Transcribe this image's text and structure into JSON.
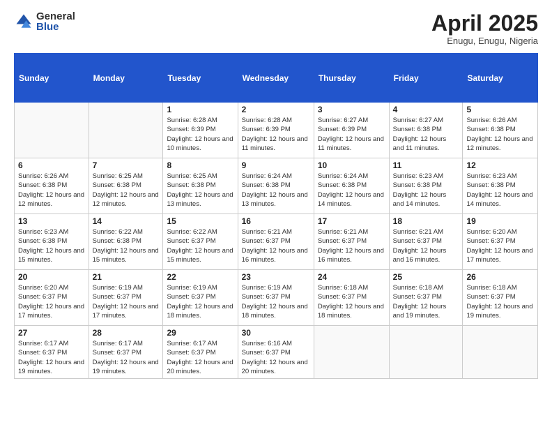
{
  "logo": {
    "general": "General",
    "blue": "Blue"
  },
  "title": {
    "month_year": "April 2025",
    "location": "Enugu, Enugu, Nigeria"
  },
  "weekdays": [
    "Sunday",
    "Monday",
    "Tuesday",
    "Wednesday",
    "Thursday",
    "Friday",
    "Saturday"
  ],
  "weeks": [
    [
      {
        "day": "",
        "info": ""
      },
      {
        "day": "",
        "info": ""
      },
      {
        "day": "1",
        "info": "Sunrise: 6:28 AM\nSunset: 6:39 PM\nDaylight: 12 hours and 10 minutes."
      },
      {
        "day": "2",
        "info": "Sunrise: 6:28 AM\nSunset: 6:39 PM\nDaylight: 12 hours and 11 minutes."
      },
      {
        "day": "3",
        "info": "Sunrise: 6:27 AM\nSunset: 6:39 PM\nDaylight: 12 hours and 11 minutes."
      },
      {
        "day": "4",
        "info": "Sunrise: 6:27 AM\nSunset: 6:38 PM\nDaylight: 12 hours and 11 minutes."
      },
      {
        "day": "5",
        "info": "Sunrise: 6:26 AM\nSunset: 6:38 PM\nDaylight: 12 hours and 12 minutes."
      }
    ],
    [
      {
        "day": "6",
        "info": "Sunrise: 6:26 AM\nSunset: 6:38 PM\nDaylight: 12 hours and 12 minutes."
      },
      {
        "day": "7",
        "info": "Sunrise: 6:25 AM\nSunset: 6:38 PM\nDaylight: 12 hours and 12 minutes."
      },
      {
        "day": "8",
        "info": "Sunrise: 6:25 AM\nSunset: 6:38 PM\nDaylight: 12 hours and 13 minutes."
      },
      {
        "day": "9",
        "info": "Sunrise: 6:24 AM\nSunset: 6:38 PM\nDaylight: 12 hours and 13 minutes."
      },
      {
        "day": "10",
        "info": "Sunrise: 6:24 AM\nSunset: 6:38 PM\nDaylight: 12 hours and 14 minutes."
      },
      {
        "day": "11",
        "info": "Sunrise: 6:23 AM\nSunset: 6:38 PM\nDaylight: 12 hours and 14 minutes."
      },
      {
        "day": "12",
        "info": "Sunrise: 6:23 AM\nSunset: 6:38 PM\nDaylight: 12 hours and 14 minutes."
      }
    ],
    [
      {
        "day": "13",
        "info": "Sunrise: 6:23 AM\nSunset: 6:38 PM\nDaylight: 12 hours and 15 minutes."
      },
      {
        "day": "14",
        "info": "Sunrise: 6:22 AM\nSunset: 6:38 PM\nDaylight: 12 hours and 15 minutes."
      },
      {
        "day": "15",
        "info": "Sunrise: 6:22 AM\nSunset: 6:37 PM\nDaylight: 12 hours and 15 minutes."
      },
      {
        "day": "16",
        "info": "Sunrise: 6:21 AM\nSunset: 6:37 PM\nDaylight: 12 hours and 16 minutes."
      },
      {
        "day": "17",
        "info": "Sunrise: 6:21 AM\nSunset: 6:37 PM\nDaylight: 12 hours and 16 minutes."
      },
      {
        "day": "18",
        "info": "Sunrise: 6:21 AM\nSunset: 6:37 PM\nDaylight: 12 hours and 16 minutes."
      },
      {
        "day": "19",
        "info": "Sunrise: 6:20 AM\nSunset: 6:37 PM\nDaylight: 12 hours and 17 minutes."
      }
    ],
    [
      {
        "day": "20",
        "info": "Sunrise: 6:20 AM\nSunset: 6:37 PM\nDaylight: 12 hours and 17 minutes."
      },
      {
        "day": "21",
        "info": "Sunrise: 6:19 AM\nSunset: 6:37 PM\nDaylight: 12 hours and 17 minutes."
      },
      {
        "day": "22",
        "info": "Sunrise: 6:19 AM\nSunset: 6:37 PM\nDaylight: 12 hours and 18 minutes."
      },
      {
        "day": "23",
        "info": "Sunrise: 6:19 AM\nSunset: 6:37 PM\nDaylight: 12 hours and 18 minutes."
      },
      {
        "day": "24",
        "info": "Sunrise: 6:18 AM\nSunset: 6:37 PM\nDaylight: 12 hours and 18 minutes."
      },
      {
        "day": "25",
        "info": "Sunrise: 6:18 AM\nSunset: 6:37 PM\nDaylight: 12 hours and 19 minutes."
      },
      {
        "day": "26",
        "info": "Sunrise: 6:18 AM\nSunset: 6:37 PM\nDaylight: 12 hours and 19 minutes."
      }
    ],
    [
      {
        "day": "27",
        "info": "Sunrise: 6:17 AM\nSunset: 6:37 PM\nDaylight: 12 hours and 19 minutes."
      },
      {
        "day": "28",
        "info": "Sunrise: 6:17 AM\nSunset: 6:37 PM\nDaylight: 12 hours and 19 minutes."
      },
      {
        "day": "29",
        "info": "Sunrise: 6:17 AM\nSunset: 6:37 PM\nDaylight: 12 hours and 20 minutes."
      },
      {
        "day": "30",
        "info": "Sunrise: 6:16 AM\nSunset: 6:37 PM\nDaylight: 12 hours and 20 minutes."
      },
      {
        "day": "",
        "info": ""
      },
      {
        "day": "",
        "info": ""
      },
      {
        "day": "",
        "info": ""
      }
    ]
  ]
}
